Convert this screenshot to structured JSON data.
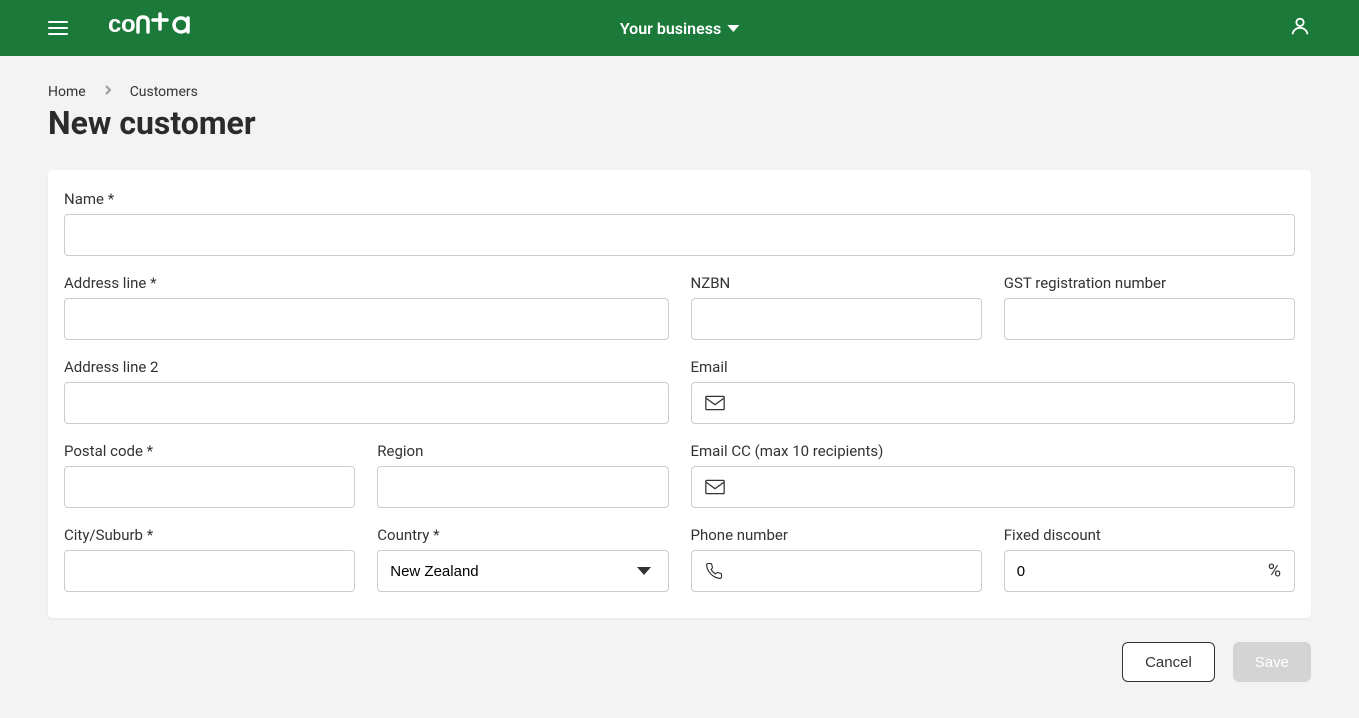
{
  "header": {
    "logo_text": "conta",
    "business_selector": "Your business"
  },
  "breadcrumb": {
    "home": "Home",
    "customers": "Customers"
  },
  "page_title": "New customer",
  "form": {
    "name": {
      "label": "Name",
      "value": ""
    },
    "address_line": {
      "label": "Address line",
      "value": ""
    },
    "address_line_2": {
      "label": "Address line 2",
      "value": ""
    },
    "postal_code": {
      "label": "Postal code",
      "value": ""
    },
    "region": {
      "label": "Region",
      "value": ""
    },
    "city_suburb": {
      "label": "City/Suburb",
      "value": ""
    },
    "country": {
      "label": "Country",
      "value": "New Zealand"
    },
    "nzbn": {
      "label": "NZBN",
      "value": ""
    },
    "gst": {
      "label": "GST registration number",
      "value": ""
    },
    "email": {
      "label": "Email",
      "value": ""
    },
    "email_cc": {
      "label": "Email CC (max 10 recipients)",
      "value": ""
    },
    "phone": {
      "label": "Phone number",
      "value": ""
    },
    "fixed_discount": {
      "label": "Fixed discount",
      "value": "0",
      "suffix": "%"
    }
  },
  "actions": {
    "cancel": "Cancel",
    "save": "Save"
  }
}
